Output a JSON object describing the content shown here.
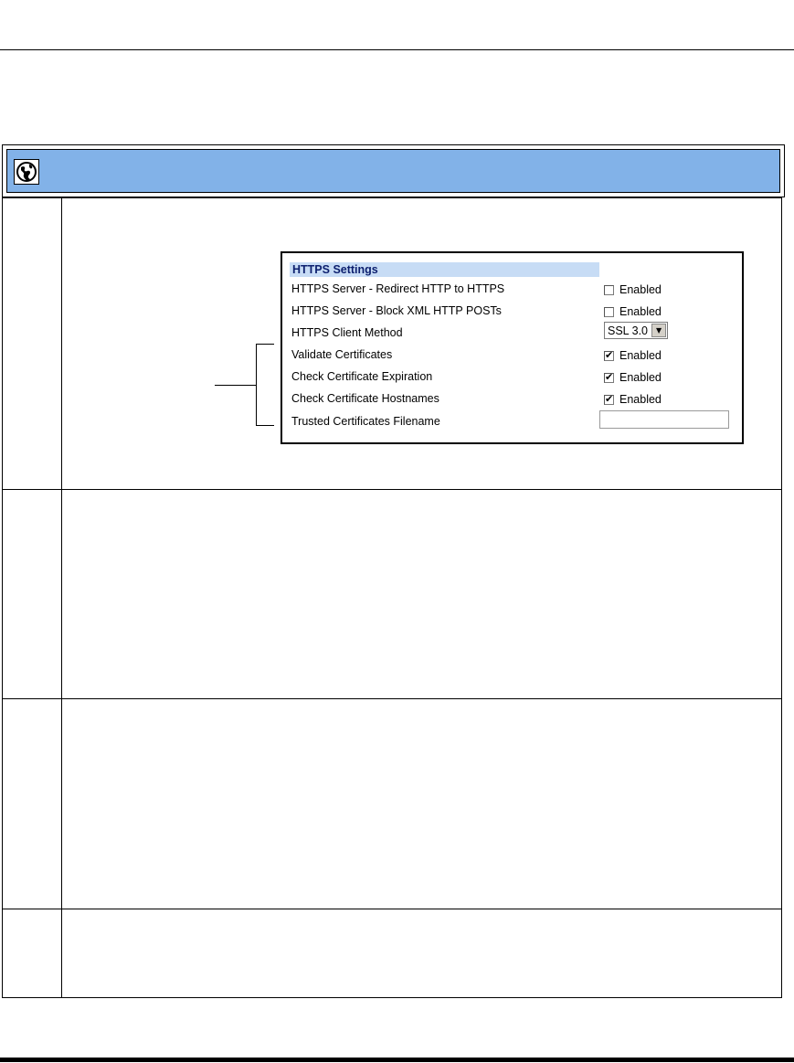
{
  "https_settings": {
    "title": "HTTPS Settings",
    "rows": [
      {
        "label": "HTTPS Server - Redirect HTTP to HTTPS",
        "control": "checkbox",
        "checked": false,
        "value_label": "Enabled"
      },
      {
        "label": "HTTPS Server - Block XML HTTP POSTs",
        "control": "checkbox",
        "checked": false,
        "value_label": "Enabled"
      },
      {
        "label": "HTTPS Client Method",
        "control": "select",
        "selected": "SSL 3.0"
      },
      {
        "label": "Validate Certificates",
        "control": "checkbox",
        "checked": true,
        "value_label": "Enabled"
      },
      {
        "label": "Check Certificate Expiration",
        "control": "checkbox",
        "checked": true,
        "value_label": "Enabled"
      },
      {
        "label": "Check Certificate Hostnames",
        "control": "checkbox",
        "checked": true,
        "value_label": "Enabled"
      },
      {
        "label": "Trusted Certificates Filename",
        "control": "text",
        "value": ""
      }
    ]
  },
  "icons": {
    "banner_icon": "globe-icon",
    "dropdown_icon": "chevron-down-icon"
  },
  "colors": {
    "banner": "#82b2e8",
    "panel_header": "#c7dcf5",
    "panel_header_text": "#0c1f6e"
  }
}
